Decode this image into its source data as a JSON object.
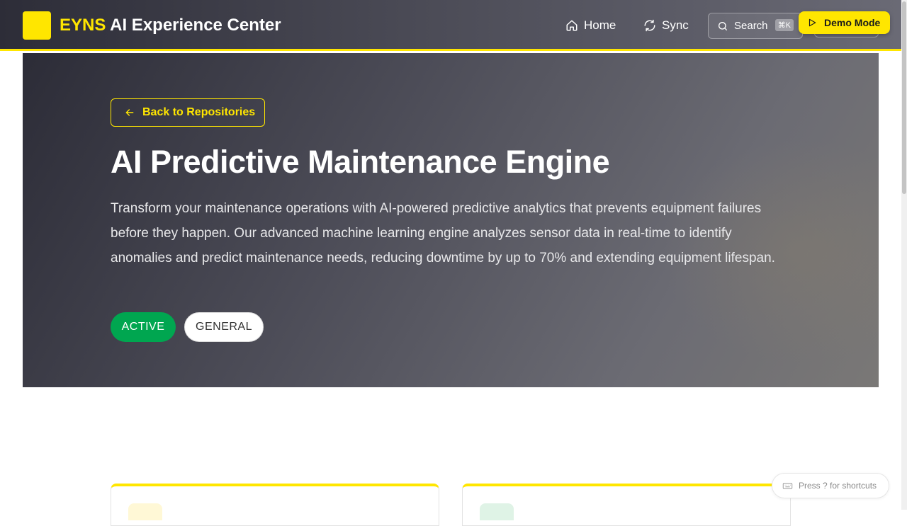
{
  "header": {
    "brand_accent": "EYNS",
    "brand_rest": "AI Experience Center",
    "nav": {
      "home": "Home",
      "sync": "Sync"
    },
    "search": {
      "label": "Search",
      "shortcut": "⌘K"
    },
    "demo_button": "Demo Mode"
  },
  "hero": {
    "back_label": "Back to Repositories",
    "title": "AI Predictive Maintenance Engine",
    "description": "Transform your maintenance operations with AI-powered predictive analytics that prevents equipment failures before they happen. Our advanced machine learning engine analyzes sensor data in real-time to identify anomalies and predict maintenance needs, reducing downtime by up to 70% and extending equipment lifespan.",
    "badges": [
      "ACTIVE",
      "GENERAL"
    ]
  },
  "shortcut_hint": "Press ? for shortcuts",
  "colors": {
    "accent": "#ffe600",
    "active_badge": "#00a650",
    "header_bg": "#3a3a45"
  },
  "icons": {
    "home": "home-icon",
    "sync": "sync-icon",
    "search": "search-icon",
    "demo": "play-icon",
    "back": "arrow-left-icon",
    "shortcut": "keyboard-icon"
  }
}
